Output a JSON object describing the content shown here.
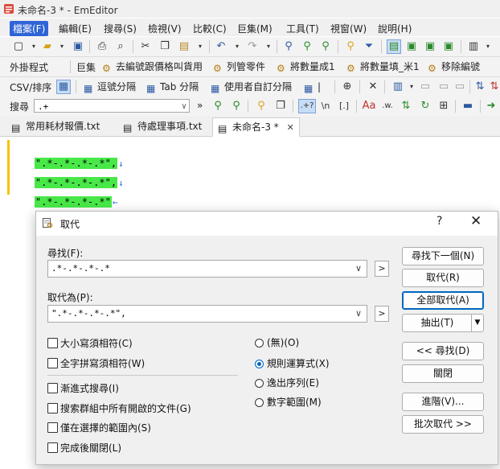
{
  "window": {
    "title": "未命名-3 * - EmEditor"
  },
  "menu": [
    "檔案(F)",
    "編輯(E)",
    "搜尋(S)",
    "檢視(V)",
    "比較(C)",
    "巨集(M)",
    "工具(T)",
    "視窗(W)",
    "說明(H)"
  ],
  "toolbar2": {
    "plugins_label": "外掛程式",
    "macros_label": "巨集",
    "macro_items": [
      "去編號跟價格叫貨用",
      "列管零件",
      "將數量成1",
      "將數量填_米1",
      "移除編號"
    ]
  },
  "toolbar3": {
    "csv_label": "CSV/排序",
    "items": [
      "逗號分隔",
      "Tab 分隔",
      "使用者自訂分隔"
    ],
    "pipe_label": "|"
  },
  "toolbar4": {
    "search_label": "搜尋",
    "search_value": ".+",
    "more": "»",
    "regex_label": ".+?",
    "newline_label": "\\n",
    "bracket_label": "[.]",
    "case_label": "Aa",
    "word_label": ".w."
  },
  "tabs": [
    "常用耗材報價.txt",
    "待處理事項.txt",
    "未命名-3 *"
  ],
  "tab_close": "✕",
  "editor": {
    "lines": [
      "\".*-.*-.*-.*\",",
      "\".*-.*-.*-.*\",",
      "\".*-.*-.*-.*\""
    ],
    "eol_marks": [
      "↓",
      "↓",
      "←"
    ]
  },
  "dialog": {
    "title": "取代",
    "help": "?",
    "close": "✕",
    "find_label": "尋找(F):",
    "find_value": ".*-.*-.*-.*",
    "replace_label": "取代為(P):",
    "replace_value": "\".*-.*-.*-.*\",",
    "arrow": ">",
    "dropdown": "∨",
    "checkboxes_top": [
      "大小寫須相符(C)",
      "全字拼寫須相符(W)"
    ],
    "checkboxes_bottom": [
      "漸進式搜尋(I)",
      "搜索群組中所有開啟的文件(G)",
      "僅在選擇的範圍內(S)",
      "完成後關閉(L)"
    ],
    "radios": [
      "(無)(O)",
      "規則運算式(X)",
      "逸出序列(E)",
      "數字範圍(M)"
    ],
    "radio_selected": 1,
    "buttons": {
      "find_next": "尋找下一個(N)",
      "replace": "取代(R)",
      "replace_all": "全部取代(A)",
      "extract": "抽出(T)",
      "find_back": "<< 尋找(D)",
      "close": "關閉",
      "advanced": "進階(V)...",
      "batch": "批次取代 >>"
    }
  },
  "colors": {
    "highlight": "#48e848",
    "modified_bar": "#f5c400",
    "accent": "#0067c0",
    "menu_active": "#2f64d6"
  }
}
